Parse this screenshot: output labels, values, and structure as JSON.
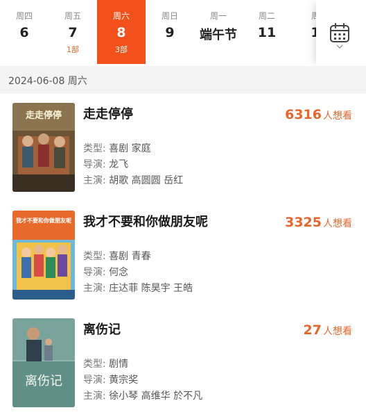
{
  "calendar": {
    "days": [
      {
        "weekday": "周四",
        "day": "6",
        "count": ""
      },
      {
        "weekday": "周五",
        "day": "7",
        "count": "1部"
      },
      {
        "weekday": "周六",
        "day": "8",
        "count": "3部"
      },
      {
        "weekday": "周日",
        "day": "9",
        "count": ""
      },
      {
        "weekday": "周一",
        "day": "端午节",
        "count": ""
      },
      {
        "weekday": "周二",
        "day": "11",
        "count": ""
      },
      {
        "weekday": "周",
        "day": "1",
        "count": ""
      }
    ],
    "selected_index": 2,
    "calendar_icon": "calendar-icon"
  },
  "date_header": "2024-06-08 周六",
  "labels": {
    "genre": "类型:",
    "director": "导演:",
    "cast": "主演:",
    "want_unit": "人想看"
  },
  "movies": [
    {
      "title": "走走停停",
      "want_count": "6316",
      "genre": "喜剧 家庭",
      "director": "龙飞",
      "cast": "胡歌 高圆圆 岳红",
      "poster_text": "走走停停"
    },
    {
      "title": "我才不要和你做朋友呢",
      "want_count": "3325",
      "genre": "喜剧 青春",
      "director": "何念",
      "cast": "庄达菲 陈昊宇 王皓",
      "poster_text": "我才不要和你做朋友呢"
    },
    {
      "title": "离伤记",
      "want_count": "27",
      "genre": "剧情",
      "director": "黄宗奖",
      "cast": "徐小琴 高维华 於不凡",
      "poster_text": "离伤记"
    }
  ],
  "colors": {
    "accent": "#f2511b",
    "want_text": "#e8662c",
    "header_bg": "#f4f4f4"
  }
}
